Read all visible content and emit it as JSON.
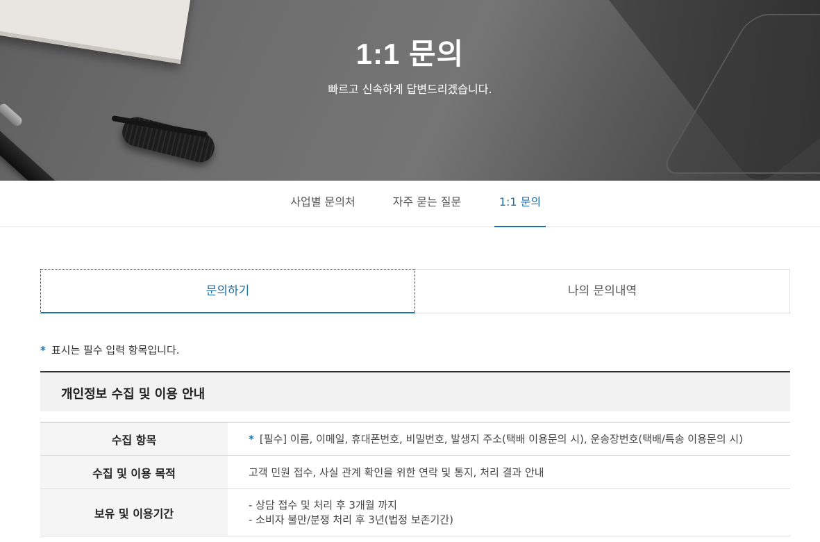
{
  "hero": {
    "title": "1:1 문의",
    "subtitle": "빠르고 신속하게 답변드리겠습니다."
  },
  "tabs": [
    {
      "label": "사업별 문의처",
      "active": false
    },
    {
      "label": "자주 묻는 질문",
      "active": false
    },
    {
      "label": "1:1 문의",
      "active": true
    }
  ],
  "subtabs": [
    {
      "label": "문의하기",
      "active": true
    },
    {
      "label": "나의 문의내역",
      "active": false
    }
  ],
  "required_note": {
    "star": "*",
    "text": "표시는 필수 입력 항목입니다."
  },
  "section": {
    "title": "개인정보 수집 및 이용 안내"
  },
  "info_rows": [
    {
      "label": "수집 항목",
      "star": "*",
      "value": "[필수] 이름, 이메일, 휴대폰번호, 비밀번호, 발생지 주소(택배 이용문의 시), 운송장번호(택배/특송 이용문의 시)"
    },
    {
      "label": "수집 및 이용 목적",
      "value": "고객 민원 접수, 사실 관계 확인을 위한 연락 및 통지, 처리 결과 안내"
    },
    {
      "label": "보유 및 이용기간",
      "lines": [
        "- 상담 접수 및 처리 후 3개월 까지",
        "- 소비자 불만/분쟁 처리 후 3년(법정 보존기간)"
      ]
    }
  ],
  "colors": {
    "accent": "#1e6fa8",
    "section_bg": "#f2f2f2",
    "label_bg": "#f5f5f5"
  }
}
